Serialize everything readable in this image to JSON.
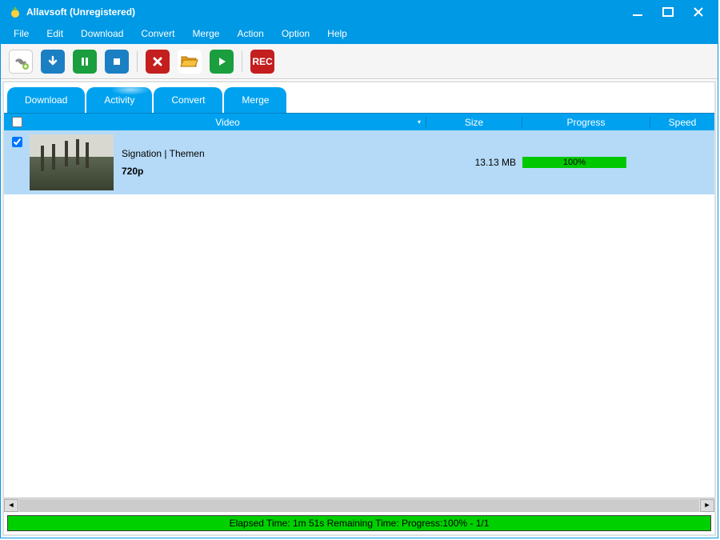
{
  "titlebar": {
    "title": "Allavsoft (Unregistered)"
  },
  "menu": {
    "file": "File",
    "edit": "Edit",
    "download": "Download",
    "convert": "Convert",
    "merge": "Merge",
    "action": "Action",
    "option": "Option",
    "help": "Help"
  },
  "toolbar": {
    "rec": "REC"
  },
  "tabs": {
    "download": "Download",
    "activity": "Activity",
    "convert": "Convert",
    "merge": "Merge"
  },
  "columns": {
    "video": "Video",
    "size": "Size",
    "progress": "Progress",
    "speed": "Speed"
  },
  "rows": [
    {
      "checked": true,
      "title": "Signation | Themen",
      "quality": "720p",
      "size": "13.13 MB",
      "progress_text": "100%",
      "progress_pct": 100
    }
  ],
  "status": "Elapsed Time: 1m 51s Remaining Time: Progress:100% - 1/1"
}
